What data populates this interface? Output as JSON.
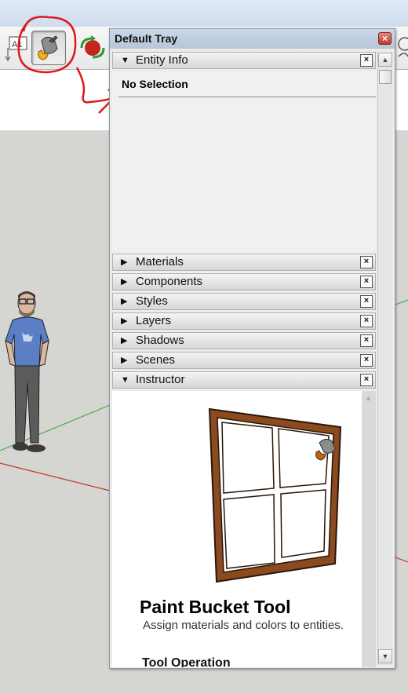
{
  "tray": {
    "title": "Default Tray",
    "close_symbol": "×"
  },
  "entity_info": {
    "label": "Entity Info",
    "selection_text": "No Selection"
  },
  "panels": [
    {
      "label": "Entity Info",
      "expanded": true
    },
    {
      "label": "Materials",
      "expanded": false
    },
    {
      "label": "Components",
      "expanded": false
    },
    {
      "label": "Styles",
      "expanded": false
    },
    {
      "label": "Layers",
      "expanded": false
    },
    {
      "label": "Shadows",
      "expanded": false
    },
    {
      "label": "Scenes",
      "expanded": false
    },
    {
      "label": "Instructor",
      "expanded": true
    }
  ],
  "panel_close_symbol": "×",
  "instructor": {
    "tool_name": "Paint Bucket Tool",
    "description": "Assign materials and colors to entities.",
    "section_heading": "Tool Operation"
  },
  "toolbar": {
    "text_tool_icon": "text-tool-icon",
    "paint_bucket_icon": "paint-bucket-icon",
    "orbit_icon": "orbit-icon"
  },
  "colors": {
    "annotation": "#e0161b",
    "axis_green": "#3cb043",
    "axis_red": "#c8332b",
    "tray_title": "#b6c5d9"
  }
}
